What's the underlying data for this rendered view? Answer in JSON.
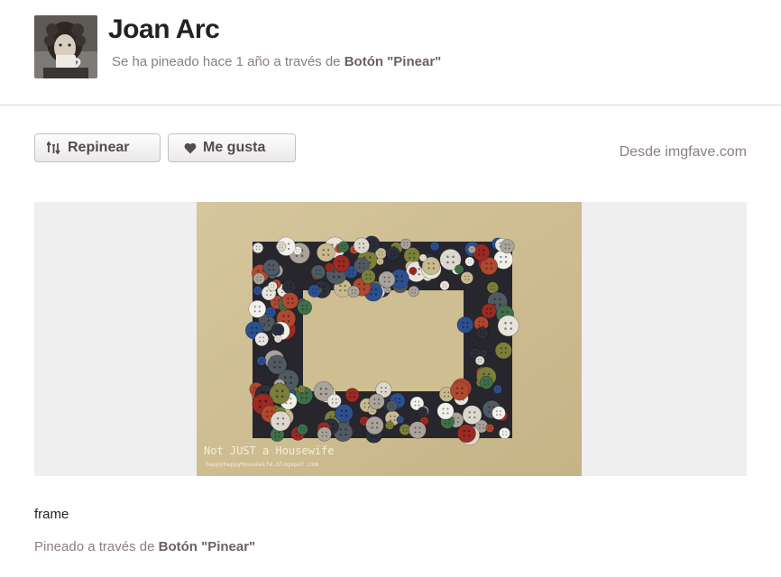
{
  "header": {
    "user_name": "Joan Arc",
    "pinned_time": "Se ha pineado hace 1 año a través de",
    "pinned_via": "Botón \"Pinear\""
  },
  "actions": {
    "repin_label": "Repinear",
    "like_label": "Me gusta",
    "repin_icon": "repin-icon",
    "like_icon": "heart-icon"
  },
  "source": {
    "text": "Desde imgfave.com"
  },
  "image": {
    "watermark_title": "Not JUST a Housewife",
    "watermark_url": "happyhappyhousewife.blogspot.com"
  },
  "caption": {
    "title": "frame",
    "pinned_prefix": "Pineado a través de",
    "pinned_via": "Botón \"Pinear\""
  },
  "colors": {
    "meta_text": "#8c7e7e",
    "button_text": "#524d4d",
    "image_background": "#efefef"
  }
}
